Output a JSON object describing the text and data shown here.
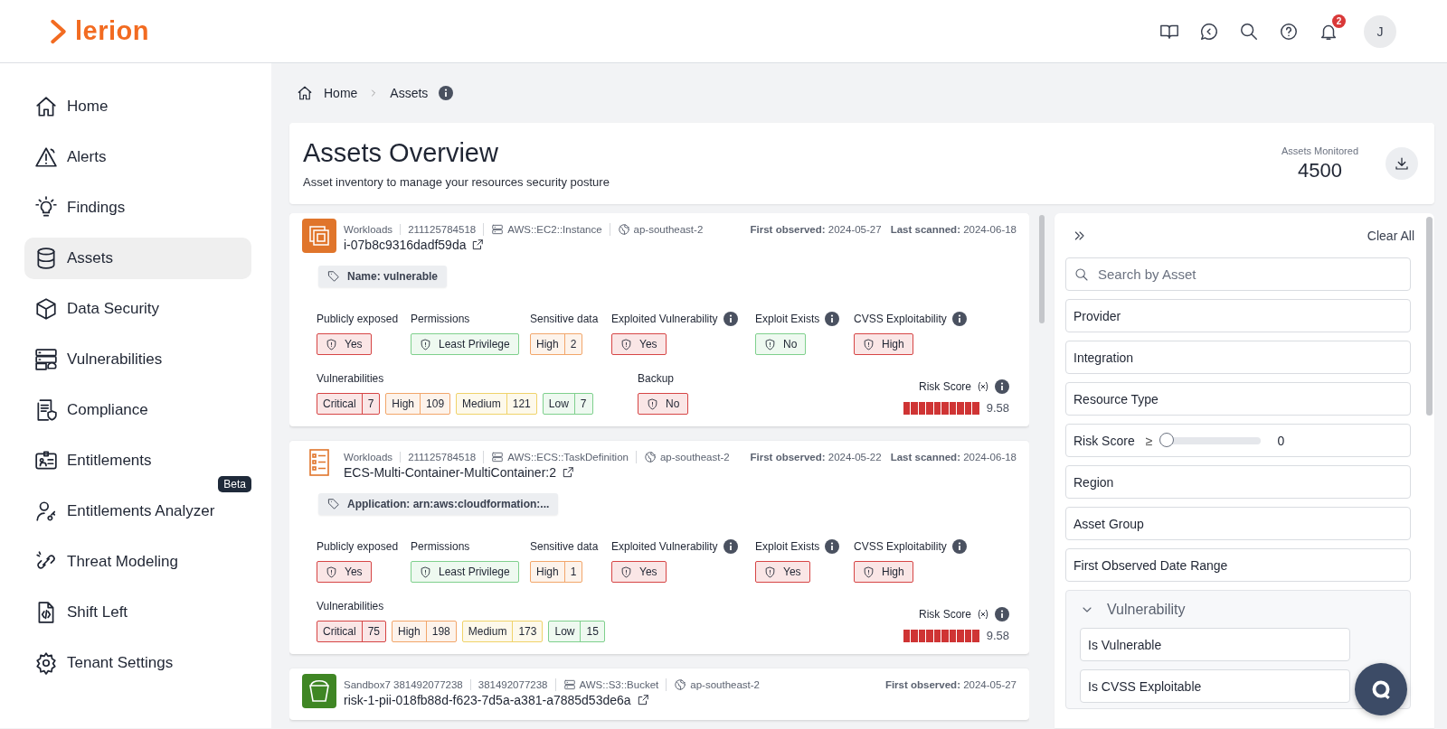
{
  "header": {
    "logo": "lerion",
    "notifications": "2",
    "avatar": "J"
  },
  "sidebar": {
    "items": [
      {
        "label": "Home",
        "selected": false
      },
      {
        "label": "Alerts",
        "selected": false
      },
      {
        "label": "Findings",
        "selected": false
      },
      {
        "label": "Assets",
        "selected": true
      },
      {
        "label": "Data Security",
        "selected": false
      },
      {
        "label": "Vulnerabilities",
        "selected": false
      },
      {
        "label": "Compliance",
        "selected": false
      },
      {
        "label": "Entitlements",
        "selected": false
      },
      {
        "label": "Entitlements Analyzer",
        "selected": false,
        "badge": "Beta"
      },
      {
        "label": "Threat Modeling",
        "selected": false
      },
      {
        "label": "Shift Left",
        "selected": false
      },
      {
        "label": "Tenant Settings",
        "selected": false
      }
    ]
  },
  "breadcrumb": [
    "Home",
    "Assets"
  ],
  "overview": {
    "title": "Assets Overview",
    "subtitle": "Asset inventory to manage your resources security posture",
    "monitored_label": "Assets Monitored",
    "monitored_value": "4500"
  },
  "assets": [
    {
      "meta": [
        "Workloads",
        "211125784518",
        "AWS::EC2::Instance",
        "ap-southeast-2"
      ],
      "first_observed_label": "First observed:",
      "first_observed": "2024-05-27",
      "last_scanned_label": "Last scanned:",
      "last_scanned": "2024-06-18",
      "name": "i-07b8c9316dadf59da",
      "tag": "Name: vulnerable",
      "attributes": [
        {
          "kind": "shield",
          "label": "Publicly exposed",
          "info": false,
          "value": "Yes",
          "color": "#d64545"
        },
        {
          "kind": "shield",
          "label": "Permissions",
          "info": false,
          "value": "Least Privilege",
          "color": "#7fd08d"
        },
        {
          "kind": "split",
          "label": "Sensitive data",
          "info": false,
          "value": "High",
          "count": "2",
          "color": "#f2a66a"
        },
        {
          "kind": "shield",
          "label": "Exploited Vulnerability",
          "info": true,
          "value": "Yes",
          "color": "#d64545"
        },
        {
          "kind": "shield",
          "label": "Exploit Exists",
          "info": true,
          "value": "No",
          "color": "#7fd08d"
        },
        {
          "kind": "shield",
          "label": "CVSS Exploitability",
          "info": true,
          "value": "High",
          "color": "#d64545"
        }
      ],
      "vulnerabilities_label": "Vulnerabilities",
      "vulnerabilities": [
        {
          "label": "Critical",
          "count": "7",
          "color": "#d64545"
        },
        {
          "label": "High",
          "count": "109",
          "color": "#f2a66a"
        },
        {
          "label": "Medium",
          "count": "121",
          "color": "#f0d36a"
        },
        {
          "label": "Low",
          "count": "7",
          "color": "#7fd08d"
        }
      ],
      "backup": {
        "label": "Backup",
        "value": "No",
        "color": "#d64545"
      },
      "risk": {
        "label": "Risk Score",
        "level": 0.958,
        "score": "9.58"
      }
    },
    {
      "meta": [
        "Workloads",
        "211125784518",
        "AWS::ECS::TaskDefinition",
        "ap-southeast-2"
      ],
      "first_observed_label": "First observed:",
      "first_observed": "2024-05-22",
      "last_scanned_label": "Last scanned:",
      "last_scanned": "2024-06-18",
      "name": "ECS-Multi-Container-MultiContainer:2",
      "tag": "Application: arn:aws:cloudformation:...",
      "attributes": [
        {
          "kind": "shield",
          "label": "Publicly exposed",
          "info": false,
          "value": "Yes",
          "color": "#d64545"
        },
        {
          "kind": "shield",
          "label": "Permissions",
          "info": false,
          "value": "Least Privilege",
          "color": "#7fd08d"
        },
        {
          "kind": "split",
          "label": "Sensitive data",
          "info": false,
          "value": "High",
          "count": "1",
          "color": "#f2a66a"
        },
        {
          "kind": "shield",
          "label": "Exploited Vulnerability",
          "info": true,
          "value": "Yes",
          "color": "#d64545"
        },
        {
          "kind": "shield",
          "label": "Exploit Exists",
          "info": true,
          "value": "Yes",
          "color": "#d64545"
        },
        {
          "kind": "shield",
          "label": "CVSS Exploitability",
          "info": true,
          "value": "High",
          "color": "#d64545"
        }
      ],
      "vulnerabilities_label": "Vulnerabilities",
      "vulnerabilities": [
        {
          "label": "Critical",
          "count": "75",
          "color": "#d64545"
        },
        {
          "label": "High",
          "count": "198",
          "color": "#f2a66a"
        },
        {
          "label": "Medium",
          "count": "173",
          "color": "#f0d36a"
        },
        {
          "label": "Low",
          "count": "15",
          "color": "#7fd08d"
        }
      ],
      "risk": {
        "label": "Risk Score",
        "level": 0.958,
        "score": "9.58"
      }
    },
    {
      "meta": [
        "Sandbox7 381492077238",
        "381492077238",
        "AWS::S3::Bucket",
        "ap-southeast-2"
      ],
      "first_observed_label": "First observed:",
      "first_observed": "2024-05-27",
      "name": "risk-1-pii-018fb88d-f623-7d5a-a381-a7885d53de6a"
    }
  ],
  "filters": {
    "clear": "Clear All",
    "search_placeholder": "Search by Asset",
    "items": [
      {
        "kind": "select",
        "label": "Provider"
      },
      {
        "kind": "select",
        "label": "Integration"
      },
      {
        "kind": "select",
        "label": "Resource Type"
      },
      {
        "kind": "slider",
        "label": "Risk Score",
        "operator": "≥",
        "level": 0,
        "value": "0"
      },
      {
        "kind": "select",
        "label": "Region"
      },
      {
        "kind": "select",
        "label": "Asset Group"
      },
      {
        "kind": "select",
        "label": "First Observed Date Range"
      },
      {
        "kind": "group",
        "label": "Vulnerability",
        "expanded": true,
        "children": [
          {
            "kind": "select",
            "label": "Is Vulnerable"
          },
          {
            "kind": "select",
            "label": "Is CVSS Exploitable"
          }
        ]
      }
    ]
  }
}
